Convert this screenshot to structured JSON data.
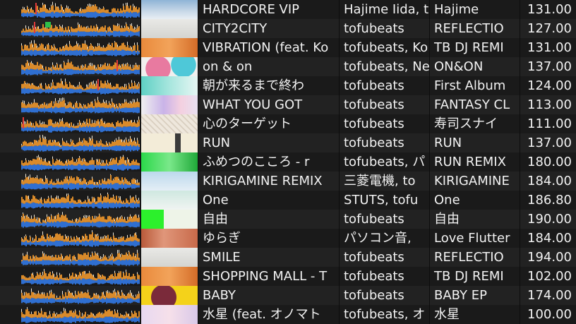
{
  "columns": [
    "waveform",
    "artwork",
    "title",
    "artist",
    "album",
    "bpm"
  ],
  "tracks": [
    {
      "title": "HARDCORE VIP",
      "artist": "Hajime Iida, t",
      "album": "Hajime",
      "bpm": "131.00",
      "art": "sky",
      "marker": "cue-red"
    },
    {
      "title": "CITY2CITY",
      "artist": "tofubeats",
      "album": "REFLECTIO",
      "bpm": "127.00",
      "art": "pale",
      "marker": "cue-red-green"
    },
    {
      "title": "VIBRATION (feat. Ko",
      "artist": "tofubeats, Ko",
      "album": "TB DJ REMI",
      "bpm": "131.00",
      "art": "orange",
      "marker": ""
    },
    {
      "title": "on & on",
      "artist": "tofubeats, Ne",
      "album": "ON&ON",
      "bpm": "137.00",
      "art": "pink",
      "marker": "cue-red-right"
    },
    {
      "title": "朝が来るまで終わ",
      "artist": "tofubeats",
      "album": "First Album",
      "bpm": "124.00",
      "art": "teal",
      "marker": "cue-red-mid"
    },
    {
      "title": "WHAT YOU GOT",
      "artist": "tofubeats",
      "album": "FANTASY CL",
      "bpm": "113.00",
      "art": "purple",
      "marker": ""
    },
    {
      "title": "心のターゲット",
      "artist": "tofubeats",
      "album": "寿司スナイ",
      "bpm": "111.00",
      "art": "sketch",
      "marker": "cue-red-left"
    },
    {
      "title": "RUN",
      "artist": "tofubeats",
      "album": "RUN",
      "bpm": "137.00",
      "art": "cream",
      "marker": ""
    },
    {
      "title": "ふめつのこころ - r",
      "artist": "tofubeats, パ",
      "album": "RUN REMIX",
      "bpm": "180.00",
      "art": "green",
      "marker": ""
    },
    {
      "title": "KIRIGAMINE REMIX",
      "artist": "三菱電機, to",
      "album": "KIRIGAMINE",
      "bpm": "184.00",
      "art": "lightblue",
      "marker": ""
    },
    {
      "title": "One",
      "artist": "STUTS, tofu",
      "album": "One",
      "bpm": "186.80",
      "art": "mint",
      "marker": ""
    },
    {
      "title": "自由",
      "artist": "tofubeats",
      "album": "自由",
      "bpm": "190.00",
      "art": "limegreen",
      "marker": ""
    },
    {
      "title": "ゆらぎ",
      "artist": "パソコン音,",
      "album": "Love Flutter",
      "bpm": "184.00",
      "art": "rust",
      "marker": ""
    },
    {
      "title": "SMILE",
      "artist": "tofubeats",
      "album": "REFLECTIO",
      "bpm": "194.00",
      "art": "pale",
      "marker": ""
    },
    {
      "title": "SHOPPING MALL - T",
      "artist": "tofubeats",
      "album": "TB DJ REMI",
      "bpm": "102.00",
      "art": "orange",
      "marker": ""
    },
    {
      "title": "BABY",
      "artist": "tofubeats",
      "album": "BABY EP",
      "bpm": "174.00",
      "art": "yellow",
      "marker": ""
    },
    {
      "title": "水星 (feat. オノマト",
      "artist": "tofubeats, オ",
      "album": "水星",
      "bpm": "100.00",
      "art": "lilac",
      "marker": ""
    }
  ],
  "colors": {
    "wave_blue": "#2f6fd1",
    "wave_orange": "#d98a2a",
    "wave_white": "#f3ead8",
    "cue_red": "#e23a3a",
    "cue_green": "#2fbf4a"
  }
}
